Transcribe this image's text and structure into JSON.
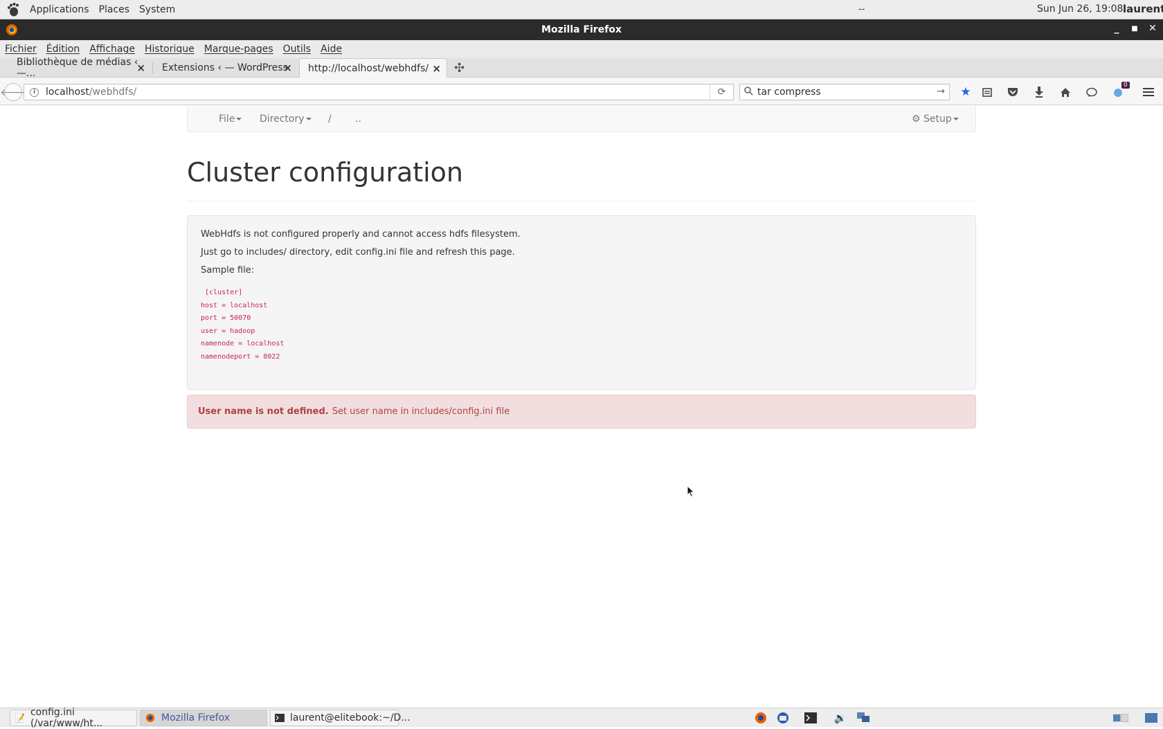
{
  "top_panel": {
    "menus": [
      "Applications",
      "Places",
      "System"
    ],
    "center_text": "--",
    "clock": "Sun Jun 26, 19:08",
    "user": "laurent"
  },
  "window": {
    "title": "Mozilla Firefox"
  },
  "menubar": {
    "items": [
      {
        "label": "Fichier",
        "accel": "F"
      },
      {
        "label": "Édition",
        "accel": "É"
      },
      {
        "label": "Affichage",
        "accel": "A"
      },
      {
        "label": "Historique",
        "accel": "H"
      },
      {
        "label": "Marque-pages",
        "accel": "M"
      },
      {
        "label": "Outils",
        "accel": "O"
      },
      {
        "label": "Aide",
        "accel": "A"
      }
    ]
  },
  "tabs": [
    {
      "label": "Bibliothèque de médias ‹ —...",
      "active": false
    },
    {
      "label": "Extensions ‹ — WordPress",
      "active": false
    },
    {
      "label": "http://localhost/webhdfs/",
      "active": true
    }
  ],
  "navbar": {
    "url_host": "localhost",
    "url_path": "/webhdfs/",
    "search_value": "tar compress",
    "notification_count": "0"
  },
  "page": {
    "nav": {
      "file": "File",
      "directory": "Directory",
      "root": "/",
      "parent": "..",
      "setup": "Setup"
    },
    "title": "Cluster configuration",
    "well": {
      "line1": "WebHdfs is not configured properly and cannot access hdfs filesystem.",
      "line2": "Just go to includes/ directory, edit config.ini file and refresh this page.",
      "line3": "Sample file:",
      "code": " [cluster]\nhost = localhost\nport = 50070\nuser = hadoop\nnamenode = localhost\nnamenodeport = 8022"
    },
    "alert": {
      "strong": "User name is not defined.",
      "text": "Set user name in includes/config.ini file"
    }
  },
  "taskbar": {
    "tasks": [
      {
        "label": "config.ini (/var/www/ht...",
        "icon": "text-editor-icon"
      },
      {
        "label": "Mozilla Firefox",
        "icon": "firefox-icon"
      },
      {
        "label": "laurent@elitebook:~/D...",
        "icon": "terminal-icon"
      }
    ]
  }
}
